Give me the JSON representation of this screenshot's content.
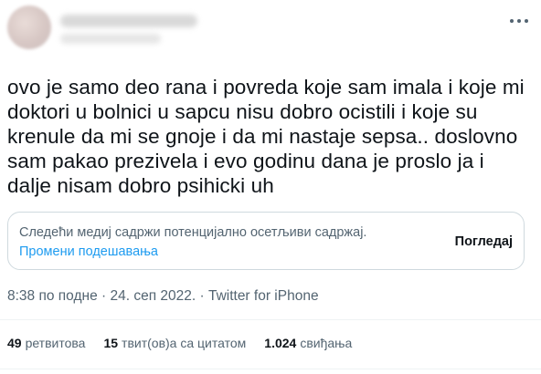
{
  "tweet": {
    "text": "ovo je samo deo rana i povreda koje sam imala i koje mi\ndoktori u bolnici u sapcu nisu dobro ocistili i koje su\nkrenule da mi se gnoje i da mi nastaje sepsa.. doslovno\nsam pakao prezivela i evo godinu dana je proslo ja i\ndalje nisam dobro psihicki uh",
    "sensitive_warning": "Следећи медиј садржи потенцијално осетљиви садржај.",
    "change_settings": "Промени подешавања",
    "view_label": "Погледај",
    "meta": "8:38 по подне · 24. сеп 2022. · Twitter for iPhone"
  },
  "stats": [
    {
      "number": "49",
      "label": "ретвитова"
    },
    {
      "number": "15",
      "label": "твит(ов)а са цитатом"
    },
    {
      "number": "1.024",
      "label": "свиђања"
    }
  ],
  "icons": {
    "more": "more-horizontal-icon"
  },
  "colors": {
    "text_primary": "#0f1419",
    "text_secondary": "#536471",
    "link": "#1d9bf0",
    "border": "#cfd9de"
  }
}
